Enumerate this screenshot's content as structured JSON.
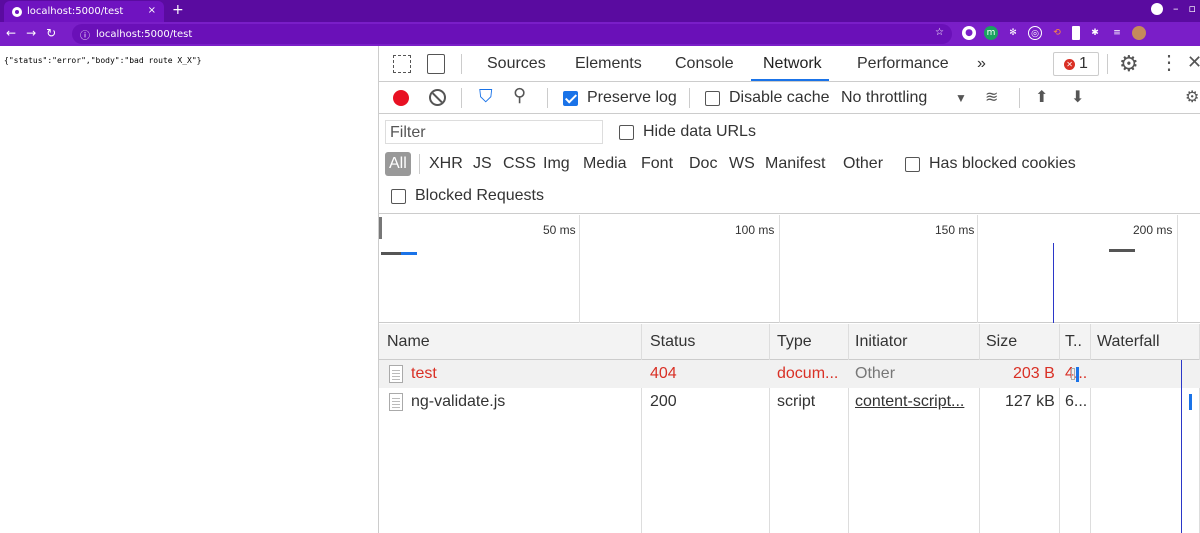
{
  "browser": {
    "tab_title": "localhost:5000/test",
    "tab_close": "×",
    "new_tab": "+",
    "url": "localhost:5000/test",
    "accent": "#7a1ec8"
  },
  "page": {
    "json_text": "{\"status\":\"error\",\"body\":\"bad route X_X\"}"
  },
  "devtools": {
    "tabs": [
      {
        "label": "Sources"
      },
      {
        "label": "Elements"
      },
      {
        "label": "Console"
      },
      {
        "label": "Network"
      },
      {
        "label": "Performance"
      }
    ],
    "more_tabs": "»",
    "error_count": "1",
    "toolbar": {
      "preserve_log": "Preserve log",
      "disable_cache": "Disable cache",
      "throttling": "No throttling"
    },
    "filter": {
      "placeholder": "Filter",
      "hide_data_urls": "Hide data URLs",
      "types": [
        "All",
        "XHR",
        "JS",
        "CSS",
        "Img",
        "Media",
        "Font",
        "Doc",
        "WS",
        "Manifest",
        "Other"
      ],
      "has_blocked_cookies": "Has blocked cookies",
      "blocked_requests": "Blocked Requests"
    },
    "overview": {
      "ticks": [
        "50 ms",
        "100 ms",
        "150 ms",
        "200 ms"
      ]
    },
    "table": {
      "columns": [
        "Name",
        "Status",
        "Type",
        "Initiator",
        "Size",
        "T..",
        "Waterfall"
      ],
      "rows": [
        {
          "name": "test",
          "status": "404",
          "type": "docum...",
          "initiator": "Other",
          "size": "203 B",
          "time": "4..."
        },
        {
          "name": "ng-validate.js",
          "status": "200",
          "type": "script",
          "initiator": "content-script...",
          "size": "127 kB",
          "time": "6..."
        }
      ]
    }
  }
}
